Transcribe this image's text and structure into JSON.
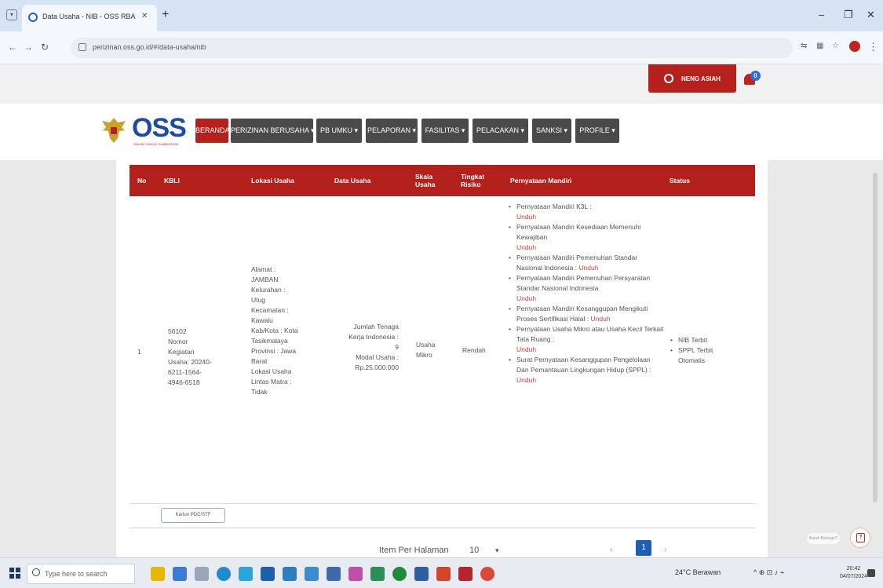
{
  "browser": {
    "tab_title": "Data Usaha - NIB - OSS RBA",
    "url": "perizinan.oss.go.id/#/data-usaha/nib"
  },
  "header": {
    "user_name": "NENG ASIAH",
    "notification_count": "0"
  },
  "brand": {
    "logo": "OSS",
    "logo_sub": "ONLINE SINGLE SUBMISSION"
  },
  "nav": {
    "items": [
      "BERANDA",
      "PERIZINAN BERUSAHA ▾",
      "PB UMKU ▾",
      "PELAPORAN ▾",
      "FASILITAS ▾",
      "PELACAKAN ▾",
      "SANKSI ▾",
      "PROFILE ▾"
    ]
  },
  "table": {
    "headers": {
      "no": "No",
      "kbli": "KBLI",
      "lokasi": "Lokasi Usaha",
      "data": "Data Usaha",
      "skala": "Skala Usaha",
      "tingkat": "Tingkat Risiko",
      "pernyataan": "Pernyataan Mandiri",
      "status": "Status"
    },
    "row": {
      "no": "1",
      "kbli_code": "56102",
      "kbli_label": "Nomor Kegiatan Usaha:",
      "kbli_value": "20240-6211-1564-4946-6518",
      "lokasi": [
        "Alamat :",
        "JAMBAN",
        "Kelurahan :",
        "Utug",
        "Kecamatan :",
        "Kawalu",
        "Kab/Kota : Kota",
        "Tasikmalaya",
        "Provinsi : Jawa",
        "Barat",
        "Lokasi Usaha",
        "Lintas Matra :",
        "Tidak"
      ],
      "data_usaha": [
        "Jumlah Tenaga",
        "Kerja Indonesia :",
        "9",
        "Modal Usaha :",
        "Rp.25.000.000"
      ],
      "skala": [
        "Usaha",
        "Mikro"
      ],
      "tingkat": "Rendah",
      "pernyataan": [
        {
          "text": "Pernyataan Mandiri K3L :",
          "link": "Unduh"
        },
        {
          "text": "Pernyataan Mandiri Kesediaan Memenuhi Kewajiban",
          "link": "Unduh"
        },
        {
          "text": "Pernyataan Mandiri Pemenuhan Standar Nasional Indonesia :",
          "link": "Unduh"
        },
        {
          "text": "Pernyataan Mandiri Pemenuhan Persyaratan Standar Nasional Indonesia",
          "link": "Unduh"
        },
        {
          "text": "Pernyataan Mandiri Kesanggupan Mengikuti Proses Sertifikasi Halal :",
          "link": "Unduh"
        },
        {
          "text": "Pernyataan Usaha Mikro atau Usaha Kecil Terkait Tata Ruang :",
          "link": "Unduh"
        },
        {
          "text": "Surat Pernyataan Kesanggupan Pengelolaan Dan Pemantauan Lingkungan Hidup (SPPL) :",
          "link": "Unduh"
        }
      ],
      "status": [
        "NIB Terbit",
        "SPPL Terbit Otomatis"
      ]
    },
    "pdf_button": "Kartun PDC/STF"
  },
  "pagination": {
    "label": "Item Per Halaman",
    "per_page": "10",
    "prev": "‹",
    "current": "1",
    "next": "›"
  },
  "help_tip": "Butuh Bantuan?",
  "taskbar": {
    "search_placeholder": "Type here to search",
    "weather": "24°C Berawan",
    "time": "20:42",
    "date": "04/07/2024"
  },
  "colors": {
    "brand_red": "#b7211d",
    "nav_dark": "#4a4a4a",
    "link_red": "#d93b2f",
    "page_blue": "#1e5fb4"
  }
}
